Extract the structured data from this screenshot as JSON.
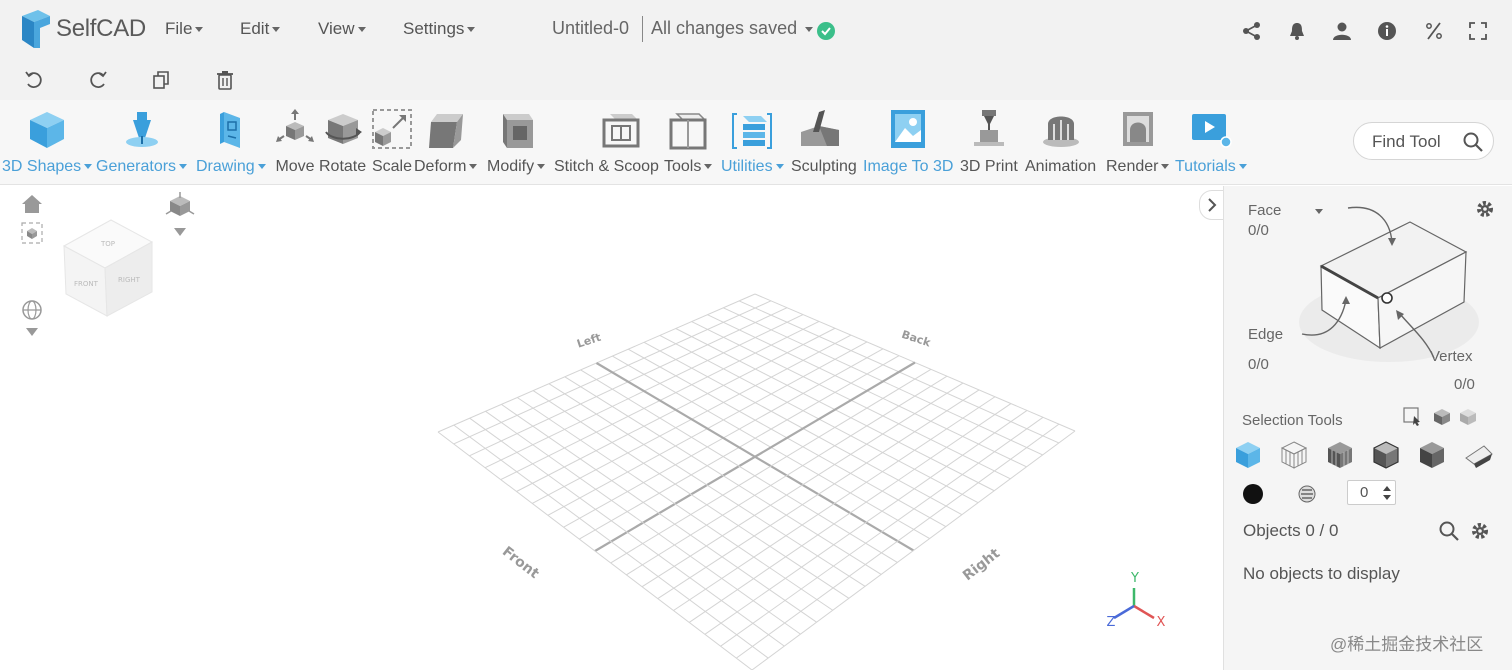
{
  "app": {
    "name": "SelfCAD"
  },
  "menus": [
    {
      "label": "File"
    },
    {
      "label": "Edit"
    },
    {
      "label": "View"
    },
    {
      "label": "Settings"
    }
  ],
  "document": {
    "title": "Untitled-0",
    "status": "All changes saved"
  },
  "top_icons": [
    "share-icon",
    "bell-icon",
    "user-icon",
    "info-icon",
    "percent-icon",
    "fullscreen-icon"
  ],
  "actions": [
    "undo-icon",
    "redo-icon",
    "copy-icon",
    "delete-icon"
  ],
  "tools": [
    {
      "label": "3D Shapes",
      "dropdown": true,
      "blue": true
    },
    {
      "label": "Generators",
      "dropdown": true,
      "blue": true
    },
    {
      "label": "Drawing",
      "dropdown": true,
      "blue": true
    },
    {
      "label": "Move",
      "dropdown": false,
      "blue": false
    },
    {
      "label": "Rotate",
      "dropdown": false,
      "blue": false
    },
    {
      "label": "Scale",
      "dropdown": false,
      "blue": false
    },
    {
      "label": "Deform",
      "dropdown": true,
      "blue": false
    },
    {
      "label": "Modify",
      "dropdown": true,
      "blue": false
    },
    {
      "label": "Stitch & Scoop",
      "dropdown": false,
      "blue": false
    },
    {
      "label": "Tools",
      "dropdown": true,
      "blue": false
    },
    {
      "label": "Utilities",
      "dropdown": true,
      "blue": true
    },
    {
      "label": "Sculpting",
      "dropdown": false,
      "blue": false
    },
    {
      "label": "Image To 3D",
      "dropdown": false,
      "blue": true
    },
    {
      "label": "3D Print",
      "dropdown": false,
      "blue": false
    },
    {
      "label": "Animation",
      "dropdown": false,
      "blue": false
    },
    {
      "label": "Render",
      "dropdown": true,
      "blue": false
    },
    {
      "label": "Tutorials",
      "dropdown": true,
      "blue": true
    }
  ],
  "find_tool": {
    "label": "Find Tool"
  },
  "view_cube": {
    "top": "TOP",
    "front": "FRONT",
    "right": "RIGHT"
  },
  "grid_labels": {
    "left": "Left",
    "back": "Back",
    "front": "Front",
    "right": "Right"
  },
  "axes": {
    "x": "X",
    "y": "Y",
    "z": "Z"
  },
  "selection_panel": {
    "mode": "Face",
    "face_count": "0/0",
    "edge_label": "Edge",
    "edge_count": "0/0",
    "vertex_label": "Vertex",
    "vertex_count": "0/0",
    "selection_tools_label": "Selection Tools",
    "thickness_value": "0"
  },
  "objects": {
    "label": "Objects 0 / 0",
    "empty_text": "No objects to display"
  },
  "watermark": "@稀土掘金技术社区",
  "colors": {
    "accent": "#4aa0d8",
    "ok": "#3bbf8a",
    "axis_x": "#e05555",
    "axis_y": "#3db86a",
    "axis_z": "#4a6ad8"
  }
}
